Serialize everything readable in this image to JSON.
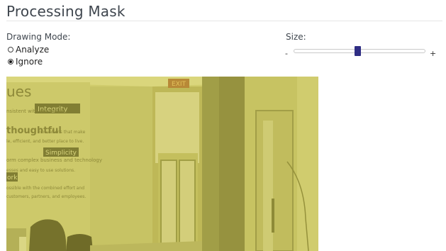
{
  "header": {
    "title": "Processing Mask"
  },
  "drawing_mode": {
    "label": "Drawing Mode:",
    "options": [
      {
        "label": "Analyze",
        "selected": false
      },
      {
        "label": "Ignore",
        "selected": true
      }
    ]
  },
  "size": {
    "label": "Size:",
    "min_label": "-",
    "max_label": "+",
    "value_fraction": 0.49
  },
  "image": {
    "overlay_color": "#c9c433",
    "wall_text": {
      "heading": "ues",
      "integrity": "Integrity",
      "line1": "nsistent with our values.",
      "thoughtful": "thoughtful",
      "line2": "innovations that make",
      "line3": "le, efficient, and better place to live.",
      "simplicity": "Simplicity",
      "line4": "orm complex business and technology",
      "line5": "esses and easy to use solutions.",
      "work": "ork",
      "line6": "ossible with the combined effort and",
      "line7": "customers, partners, and employees."
    },
    "exit_sign": "EXIT"
  }
}
